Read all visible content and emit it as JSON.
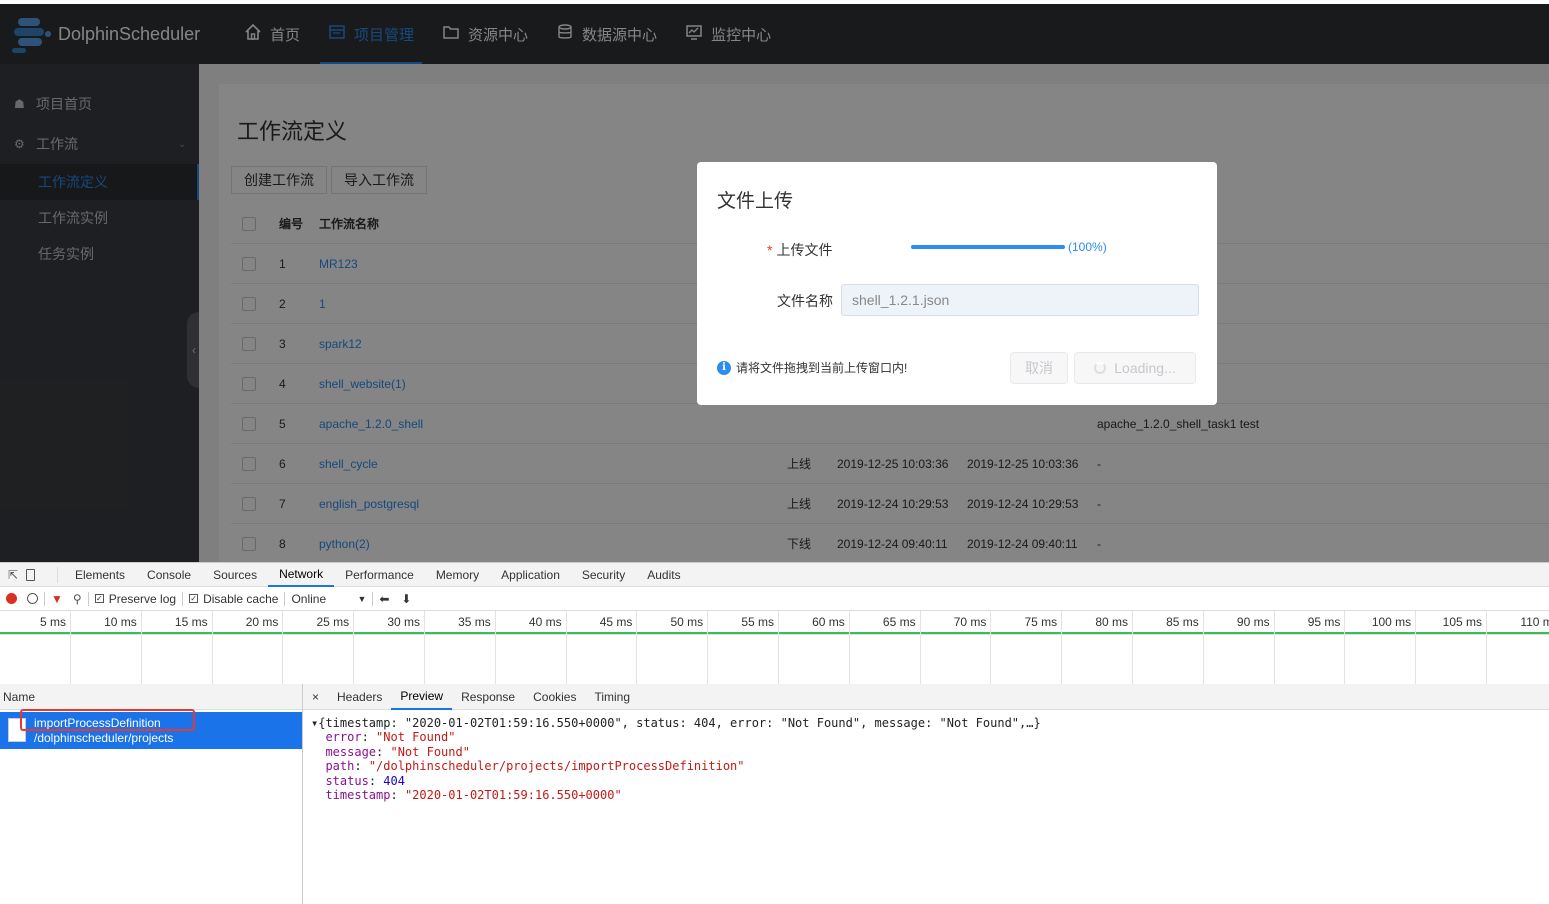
{
  "app": {
    "brand": "DolphinScheduler",
    "nav": [
      {
        "label": "首页",
        "icon": "home-icon"
      },
      {
        "label": "项目管理",
        "icon": "project-icon",
        "active": true
      },
      {
        "label": "资源中心",
        "icon": "folder-icon"
      },
      {
        "label": "数据源中心",
        "icon": "database-icon"
      },
      {
        "label": "监控中心",
        "icon": "monitor-icon"
      }
    ],
    "sidebar": {
      "home": "项目首页",
      "workflow": "工作流",
      "items": [
        "工作流定义",
        "工作流实例",
        "任务实例"
      ]
    },
    "page_title": "工作流定义",
    "toolbar": {
      "create": "创建工作流",
      "import": "导入工作流"
    },
    "table": {
      "headers": {
        "no": "编号",
        "name": "工作流名称"
      },
      "rows": [
        {
          "no": "1",
          "name": "MR123",
          "state": "",
          "created": "",
          "updated": "",
          "desc": ""
        },
        {
          "no": "2",
          "name": "1",
          "state": "",
          "created": "",
          "updated": "",
          "desc": ""
        },
        {
          "no": "3",
          "name": "spark12",
          "state": "",
          "created": "",
          "updated": "",
          "desc": ""
        },
        {
          "no": "4",
          "name": "shell_website(1)",
          "state": "",
          "created": "",
          "updated": "",
          "desc": ""
        },
        {
          "no": "5",
          "name": "apache_1.2.0_shell",
          "state": "",
          "created": "",
          "updated": "",
          "desc": "apache_1.2.0_shell_task1 test"
        },
        {
          "no": "6",
          "name": "shell_cycle",
          "state": "上线",
          "created": "2019-12-25 10:03:36",
          "updated": "2019-12-25 10:03:36",
          "desc": "-"
        },
        {
          "no": "7",
          "name": "english_postgresql",
          "state": "上线",
          "created": "2019-12-24 10:29:53",
          "updated": "2019-12-24 10:29:53",
          "desc": "-"
        },
        {
          "no": "8",
          "name": "python(2)",
          "state": "下线",
          "created": "2019-12-24 09:40:11",
          "updated": "2019-12-24 09:40:11",
          "desc": "-"
        }
      ]
    }
  },
  "modal": {
    "title": "文件上传",
    "upload_label": "上传文件",
    "progress_percent": 100,
    "progress_text": "(100%)",
    "filename_label": "文件名称",
    "filename_value": "shell_1.2.1.json",
    "hint": "请将文件拖拽到当前上传窗口内!",
    "cancel": "取消",
    "loading": "Loading..."
  },
  "devtools": {
    "tabs": [
      "Elements",
      "Console",
      "Sources",
      "Network",
      "Performance",
      "Memory",
      "Application",
      "Security",
      "Audits"
    ],
    "active_tab": "Network",
    "toolbar": {
      "preserve_log": "Preserve log",
      "disable_cache": "Disable cache",
      "throttle": "Online"
    },
    "ticks": [
      "5 ms",
      "10 ms",
      "15 ms",
      "20 ms",
      "25 ms",
      "30 ms",
      "35 ms",
      "40 ms",
      "45 ms",
      "50 ms",
      "55 ms",
      "60 ms",
      "65 ms",
      "70 ms",
      "75 ms",
      "80 ms",
      "85 ms",
      "90 ms",
      "95 ms",
      "100 ms",
      "105 ms",
      "110 m"
    ],
    "name_header": "Name",
    "request": {
      "name": "importProcessDefinition",
      "path": "/dolphinscheduler/projects"
    },
    "detail_tabs": [
      "Headers",
      "Preview",
      "Response",
      "Cookies",
      "Timing"
    ],
    "active_detail_tab": "Preview",
    "preview": {
      "summary": "{timestamp: \"2020-01-02T01:59:16.550+0000\", status: 404, error: \"Not Found\", message: \"Not Found\",…}",
      "error": "\"Not Found\"",
      "message": "\"Not Found\"",
      "path": "\"/dolphinscheduler/projects/importProcessDefinition\"",
      "status": "404",
      "timestamp": "\"2020-01-02T01:59:16.550+0000\""
    }
  }
}
